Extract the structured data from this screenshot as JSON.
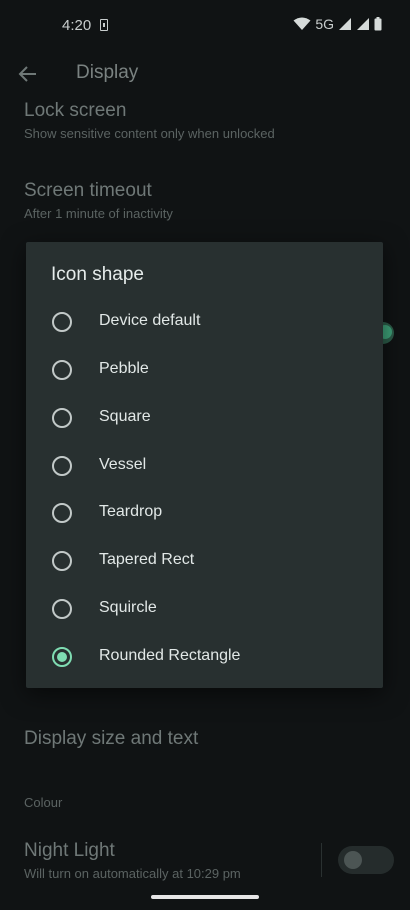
{
  "status_bar": {
    "time": "4:20",
    "network": "5G"
  },
  "app_bar": {
    "title": "Display"
  },
  "background": {
    "lock_screen": {
      "title": "Lock screen",
      "subtitle": "Show sensitive content only when unlocked"
    },
    "screen_timeout": {
      "title": "Screen timeout",
      "subtitle": "After 1 minute of inactivity"
    },
    "display_size": {
      "title": "Display size and text"
    },
    "section_colour": "Colour",
    "night_light": {
      "title": "Night Light",
      "subtitle": "Will turn on automatically at 10:29 pm"
    }
  },
  "dialog": {
    "title": "Icon shape",
    "options": [
      {
        "label": "Device default",
        "checked": false
      },
      {
        "label": "Pebble",
        "checked": false
      },
      {
        "label": "Square",
        "checked": false
      },
      {
        "label": "Vessel",
        "checked": false
      },
      {
        "label": "Teardrop",
        "checked": false
      },
      {
        "label": "Tapered Rect",
        "checked": false
      },
      {
        "label": "Squircle",
        "checked": false
      },
      {
        "label": "Rounded Rectangle",
        "checked": true
      }
    ]
  },
  "colors": {
    "accent": "#7fdcb2",
    "dialog_bg": "#283030",
    "screen_bg": "#101314"
  }
}
